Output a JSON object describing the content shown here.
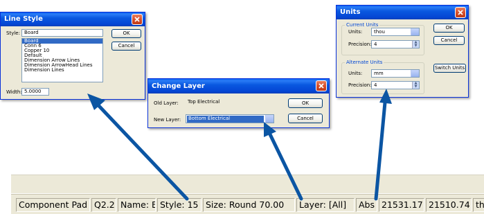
{
  "line_style": {
    "title": "Line Style",
    "style_label": "Style:",
    "style_value": "Board",
    "list_items": [
      "Board",
      "Conn 6",
      "Copper 10",
      "Default",
      "Dimension Arrow Lines",
      "Dimension ArrowHead Lines",
      "Dimension Lines"
    ],
    "selected_index": 0,
    "width_label": "Width:",
    "width_value": "5.0000",
    "ok_label": "OK",
    "cancel_label": "Cancel"
  },
  "change_layer": {
    "title": "Change Layer",
    "old_label": "Old Layer:",
    "old_value": "Top Electrical",
    "new_label": "New Layer:",
    "new_value": "Bottom Electrical",
    "ok_label": "OK",
    "cancel_label": "Cancel"
  },
  "units": {
    "title": "Units",
    "current_group": "Current Units",
    "alternate_group": "Alternate Units",
    "units_label": "Units:",
    "precision_label": "Precision:",
    "current_units": "thou",
    "current_precision": "4",
    "alternate_units": "mm",
    "alternate_precision": "4",
    "ok_label": "OK",
    "cancel_label": "Cancel",
    "switch_label": "Switch Units"
  },
  "status": {
    "panes": [
      "Component Pad",
      "Q2.2",
      "Name: B",
      "Style: 15",
      "Size: Round 70.00",
      "Layer: [All]",
      "Abs",
      "21531.17",
      "21510.74",
      "thou"
    ]
  },
  "colors": {
    "arrow": "#0b55a3",
    "title_blue": "#0a58e0",
    "selection": "#316ac5",
    "dialog_face": "#ece9d8"
  }
}
